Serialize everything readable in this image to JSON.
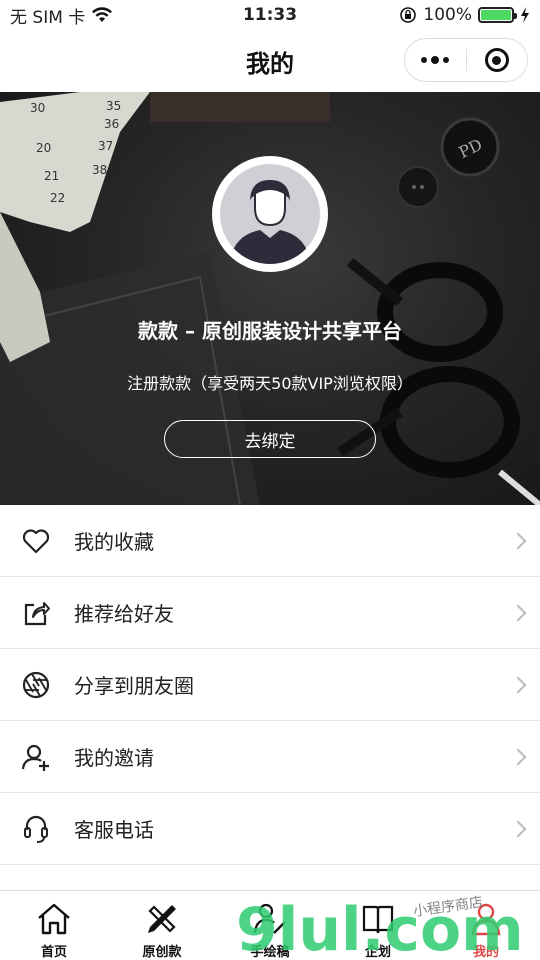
{
  "status_bar": {
    "carrier": "无 SIM 卡",
    "time": "11:33",
    "battery_percent": "100%",
    "battery_level": 1.0
  },
  "nav": {
    "title": "我的"
  },
  "profile": {
    "brand_title": "款款 – 原创服装设计共享平台",
    "register_text": "注册款款（享受两天50款VIP浏览权限）",
    "bind_button": "去绑定"
  },
  "menu": {
    "items": [
      {
        "label": "我的收藏",
        "icon": "heart-icon"
      },
      {
        "label": "推荐给好友",
        "icon": "share-out-icon"
      },
      {
        "label": "分享到朋友圈",
        "icon": "aperture-icon"
      },
      {
        "label": "我的邀请",
        "icon": "add-user-icon"
      },
      {
        "label": "客服电话",
        "icon": "headset-icon"
      }
    ]
  },
  "tab_bar": {
    "tabs": [
      {
        "label": "首页",
        "icon": "home-icon"
      },
      {
        "label": "原创款",
        "icon": "pencil-ruler-icon"
      },
      {
        "label": "手绘稿",
        "icon": "drawing-icon"
      },
      {
        "label": "企划",
        "icon": "book-icon"
      },
      {
        "label": "我的",
        "icon": "user-icon",
        "active": true
      }
    ],
    "active_color": "#e04848"
  },
  "watermark": {
    "text": "9lul.com",
    "subtext": "小程序商店"
  },
  "colors": {
    "accent_active": "#e04848",
    "watermark_green": "#2ecc71",
    "watermark_orange": "#f39c12"
  }
}
